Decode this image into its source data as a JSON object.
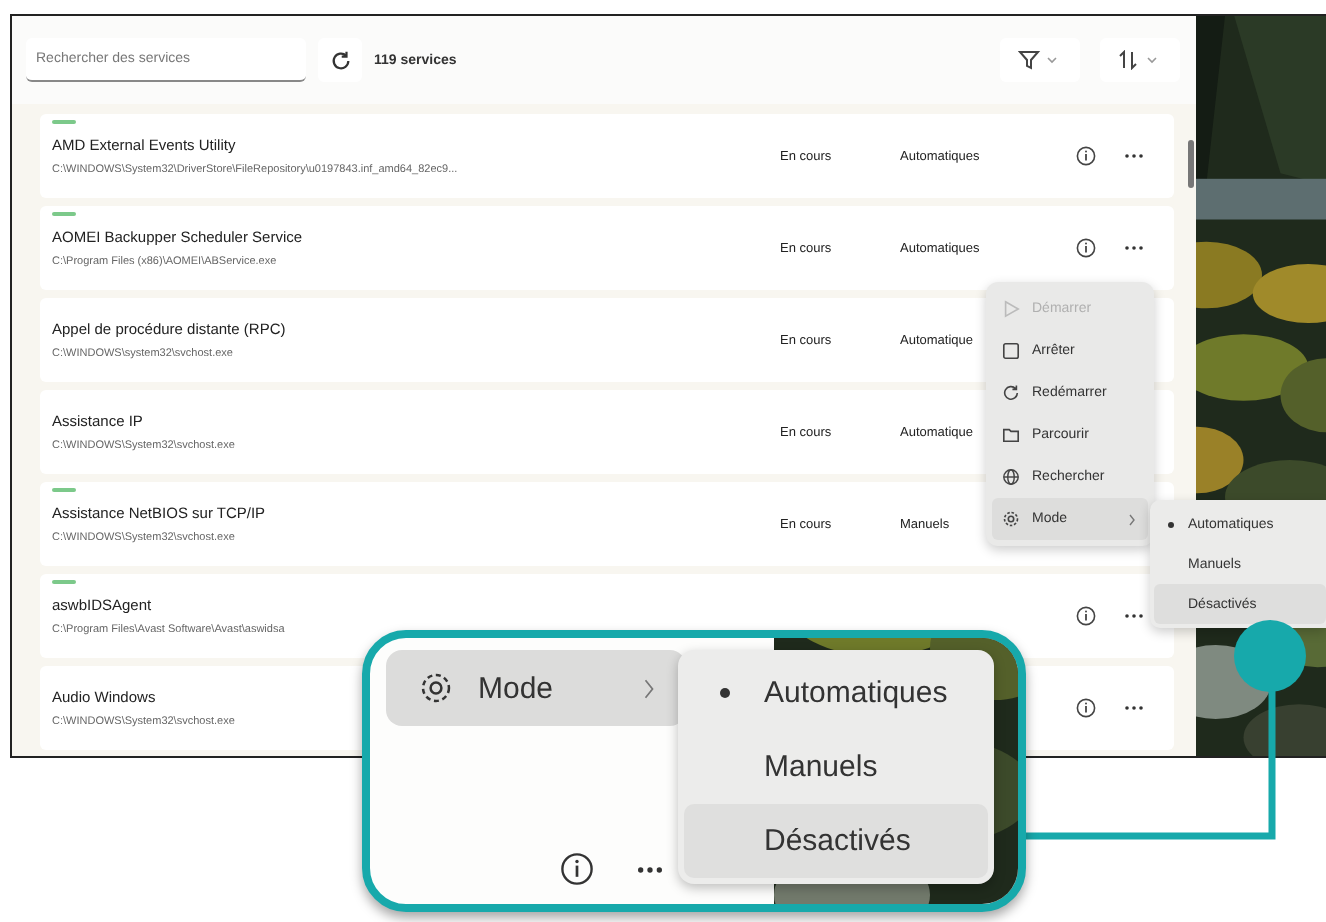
{
  "toolbar": {
    "search": {
      "placeholder": "Rechercher des services"
    },
    "count": "119 services"
  },
  "services": [
    {
      "name": "AMD External Events Utility",
      "path": "C:\\WINDOWS\\System32\\DriverStore\\FileRepository\\u0197843.inf_amd64_82ec9...",
      "running": true,
      "status": "En cours",
      "mode": "Automatiques",
      "actions": true
    },
    {
      "name": "AOMEI Backupper Scheduler Service",
      "path": "C:\\Program Files (x86)\\AOMEI\\ABService.exe",
      "running": true,
      "status": "En cours",
      "mode": "Automatiques",
      "actions": true
    },
    {
      "name": "Appel de procédure distante (RPC)",
      "path": "C:\\WINDOWS\\system32\\svchost.exe",
      "running": false,
      "status": "En cours",
      "mode": "Automatique"
    },
    {
      "name": "Assistance IP",
      "path": "C:\\WINDOWS\\System32\\svchost.exe",
      "running": false,
      "status": "En cours",
      "mode": "Automatique"
    },
    {
      "name": "Assistance NetBIOS sur TCP/IP",
      "path": "C:\\WINDOWS\\System32\\svchost.exe",
      "running": true,
      "status": "En cours",
      "mode": "Manuels"
    },
    {
      "name": "aswbIDSAgent",
      "path": "C:\\Program Files\\Avast Software\\Avast\\aswidsa",
      "running": true,
      "actions": true
    },
    {
      "name": "Audio Windows",
      "path": "C:\\WINDOWS\\System32\\svchost.exe",
      "running": false,
      "actions": true
    }
  ],
  "context_menu": {
    "items": [
      {
        "label": "Démarrer",
        "kind": "play",
        "disabled": true,
        "highlighted": false,
        "has_submenu": false
      },
      {
        "label": "Arrêter",
        "kind": "stop",
        "disabled": false,
        "highlighted": false,
        "has_submenu": false
      },
      {
        "label": "Redémarrer",
        "kind": "restart",
        "disabled": false,
        "highlighted": false,
        "has_submenu": false
      },
      {
        "label": "Parcourir",
        "kind": "folder",
        "disabled": false,
        "highlighted": false,
        "has_submenu": false
      },
      {
        "label": "Rechercher",
        "kind": "web",
        "disabled": false,
        "highlighted": false,
        "has_submenu": false
      },
      {
        "label": "Mode",
        "kind": "mode",
        "disabled": false,
        "highlighted": true,
        "has_submenu": true
      }
    ]
  },
  "submenu": {
    "items": [
      {
        "label": "Automatiques",
        "selected": true,
        "highlighted": false
      },
      {
        "label": "Manuels",
        "selected": false,
        "highlighted": false
      },
      {
        "label": "Désactivés",
        "selected": false,
        "highlighted": true
      }
    ]
  },
  "callout": {
    "mode_item": {
      "label": "Mode",
      "highlighted": true
    },
    "submenu": [
      {
        "label": "Automatiques",
        "selected": true,
        "highlighted": false
      },
      {
        "label": "Manuels",
        "selected": false,
        "highlighted": false
      },
      {
        "label": "Désactivés",
        "selected": false,
        "highlighted": true
      }
    ]
  }
}
